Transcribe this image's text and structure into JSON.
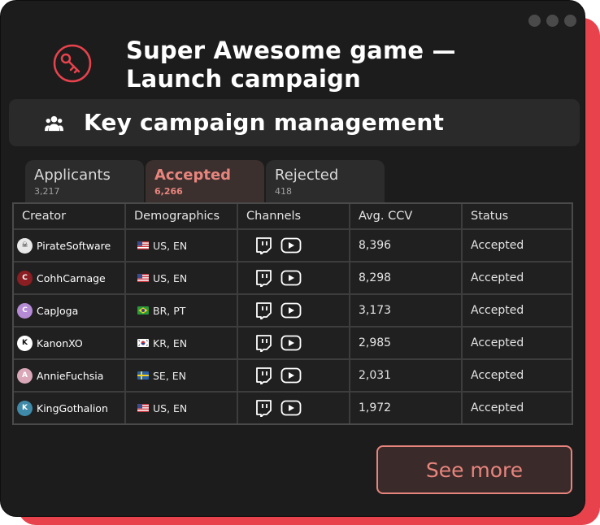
{
  "window": {
    "title_line1": "Super Awesome game —",
    "title_line2": "Launch campaign",
    "header_icon": "key-icon"
  },
  "section": {
    "title": "Key campaign management",
    "icon": "users-icon"
  },
  "tabs": [
    {
      "label": "Applicants",
      "count": "3,217",
      "active": false
    },
    {
      "label": "Accepted",
      "count": "6,266",
      "active": true
    },
    {
      "label": "Rejected",
      "count": "418",
      "active": false
    }
  ],
  "table": {
    "headers": [
      "Creator",
      "Demographics",
      "Channels",
      "Avg. CCV",
      "Status"
    ],
    "rows": [
      {
        "creator": "PirateSoftware",
        "demographics": "US, EN",
        "flag": "US",
        "channels": [
          "twitch-icon",
          "youtube-icon"
        ],
        "avg_ccv": "8,396",
        "status": "Accepted"
      },
      {
        "creator": "CohhCarnage",
        "demographics": "US, EN",
        "flag": "US",
        "channels": [
          "twitch-icon",
          "youtube-icon"
        ],
        "avg_ccv": "8,298",
        "status": "Accepted"
      },
      {
        "creator": "CapJoga",
        "demographics": "BR, PT",
        "flag": "BR",
        "channels": [
          "twitch-icon",
          "youtube-icon"
        ],
        "avg_ccv": "3,173",
        "status": "Accepted"
      },
      {
        "creator": "KanonXO",
        "demographics": "KR, EN",
        "flag": "KR",
        "channels": [
          "twitch-icon",
          "youtube-icon"
        ],
        "avg_ccv": "2,985",
        "status": "Accepted"
      },
      {
        "creator": "AnnieFuchsia",
        "demographics": "SE, EN",
        "flag": "SE",
        "channels": [
          "twitch-icon",
          "youtube-icon"
        ],
        "avg_ccv": "2,031",
        "status": "Accepted"
      },
      {
        "creator": "KingGothalion",
        "demographics": "US, EN",
        "flag": "US",
        "channels": [
          "twitch-icon",
          "youtube-icon"
        ],
        "avg_ccv": "1,972",
        "status": "Accepted"
      }
    ]
  },
  "actions": {
    "see_more_label": "See more"
  },
  "colors": {
    "accent": "#e7857d",
    "brand_red": "#e8424c",
    "window_bg": "#1c1c1c"
  }
}
